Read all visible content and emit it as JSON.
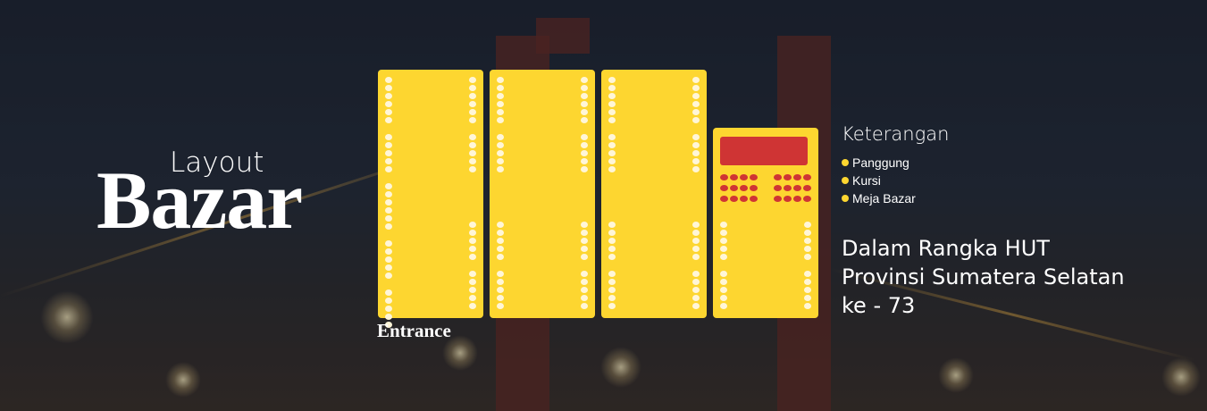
{
  "title": {
    "line1": "Layout",
    "line2": "Bazar"
  },
  "entrance_label": "Entrance",
  "legend": {
    "title": "Keterangan",
    "items": [
      "Panggung",
      "Kursi",
      "Meja Bazar"
    ]
  },
  "event_text": [
    "Dalam Rangka HUT",
    "Provinsi Sumatera Selatan",
    "ke - 73"
  ],
  "colors": {
    "block": "#fdd630",
    "stage": "#cf3434",
    "seat": "#fff6d8",
    "text": "#ffffff"
  }
}
